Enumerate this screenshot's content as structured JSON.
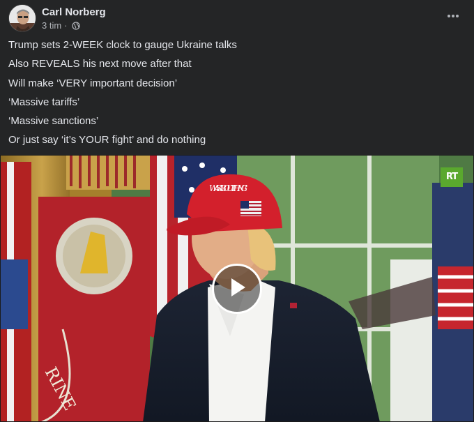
{
  "post": {
    "author": "Carl Norberg",
    "time": "3 tim",
    "separator": "·",
    "privacy_icon": "globe-icon",
    "more_icon": "more-horizontal-icon"
  },
  "text_lines": [
    "Trump sets 2-WEEK clock to gauge Ukraine talks",
    "Also REVEALS his next move after that",
    "Will make ‘VERY important decision’",
    "‘Massive tariffs’",
    "‘Massive sanctions’",
    "Or just say ‘it’s YOUR fight’ and do nothing"
  ],
  "video": {
    "watermark": "RT",
    "play_icon": "play-icon",
    "cap_text": "WAS ABOUT THING!",
    "banner_text": "RINE"
  },
  "colors": {
    "background": "#242526",
    "text_primary": "#e4e6eb",
    "text_secondary": "#b0b3b8",
    "watermark_green": "#5aa82e",
    "cap_red": "#d3202c"
  }
}
